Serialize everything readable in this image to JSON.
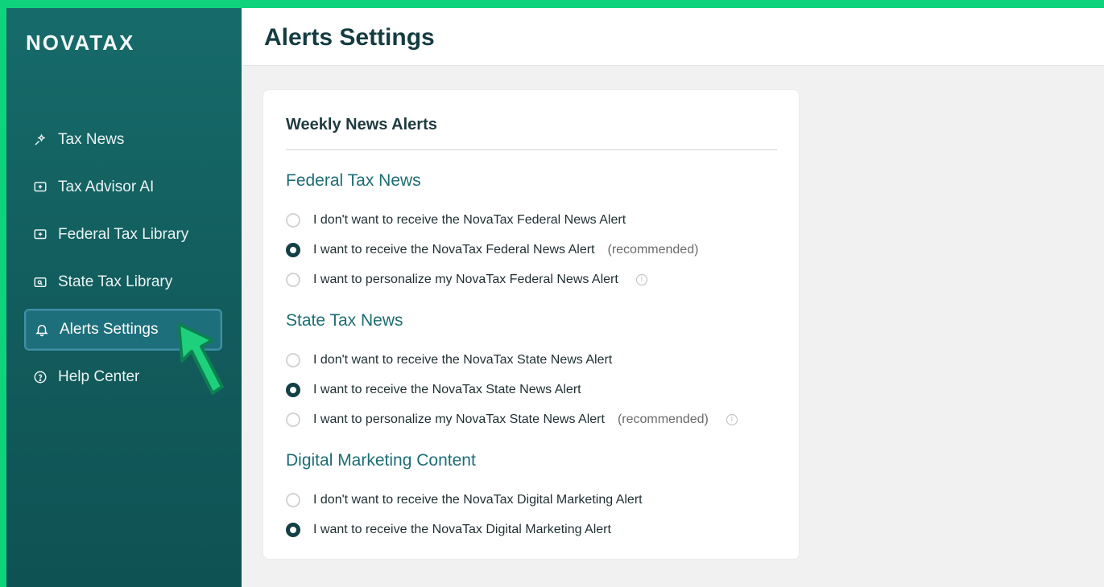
{
  "brand": {
    "logo_text": "NOVATAX"
  },
  "sidebar": {
    "items": [
      {
        "label": "Tax News",
        "icon": "sparkles-icon",
        "active": false
      },
      {
        "label": "Tax Advisor AI",
        "icon": "chat-plus-icon",
        "active": false
      },
      {
        "label": "Federal Tax Library",
        "icon": "book-plus-icon",
        "active": false
      },
      {
        "label": "State Tax Library",
        "icon": "map-search-icon",
        "active": false
      },
      {
        "label": "Alerts Settings",
        "icon": "bell-icon",
        "active": true
      },
      {
        "label": "Help Center",
        "icon": "help-circle-icon",
        "active": false
      }
    ]
  },
  "header": {
    "title": "Alerts Settings"
  },
  "card": {
    "title": "Weekly News Alerts",
    "sections": [
      {
        "title": "Federal Tax News",
        "options": [
          {
            "text": "I don't want to receive the NovaTax Federal News Alert",
            "note": "",
            "selected": false,
            "info": false
          },
          {
            "text": "I want to receive the NovaTax Federal News Alert",
            "note": "(recommended)",
            "selected": true,
            "info": false
          },
          {
            "text": "I want to personalize my NovaTax Federal News Alert",
            "note": "",
            "selected": false,
            "info": true
          }
        ]
      },
      {
        "title": "State Tax News",
        "options": [
          {
            "text": "I don't want to receive the NovaTax State News Alert",
            "note": "",
            "selected": false,
            "info": false
          },
          {
            "text": "I want to receive the NovaTax State News Alert",
            "note": "",
            "selected": true,
            "info": false
          },
          {
            "text": "I want to personalize my NovaTax State News Alert",
            "note": "(recommended)",
            "selected": false,
            "info": true
          }
        ]
      },
      {
        "title": "Digital Marketing Content",
        "options": [
          {
            "text": "I don't want to receive the NovaTax Digital Marketing Alert",
            "note": "",
            "selected": false,
            "info": false
          },
          {
            "text": "I want to receive the NovaTax Digital Marketing Alert",
            "note": "",
            "selected": true,
            "info": false
          }
        ]
      }
    ]
  },
  "colors": {
    "frame_green": "#0fd37c",
    "sidebar_teal": "#125b5c",
    "accent_teal": "#1c6d74",
    "active_bg": "#1d6f7c"
  }
}
